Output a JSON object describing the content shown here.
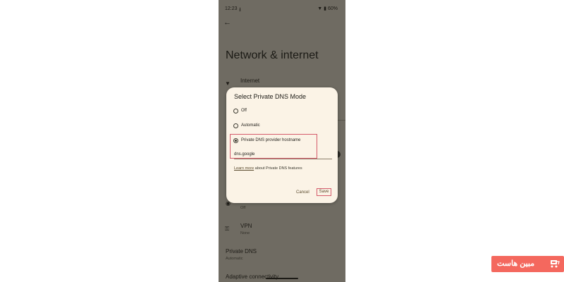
{
  "status_bar": {
    "time": "12:23",
    "battery": "60%"
  },
  "page": {
    "title": "Network & internet"
  },
  "settings_rows": {
    "internet": {
      "title": "Internet"
    },
    "hotspot": {
      "sub": "Off"
    },
    "vpn": {
      "title": "VPN",
      "sub": "None"
    },
    "private_dns": {
      "title": "Private DNS",
      "sub": "Automatic"
    },
    "adaptive": {
      "title": "Adaptive connectivity"
    }
  },
  "dialog": {
    "title": "Select Private DNS Mode",
    "options": [
      {
        "label": "Off",
        "checked": false
      },
      {
        "label": "Automatic",
        "checked": false
      },
      {
        "label": "Private DNS provider hostname",
        "checked": true
      }
    ],
    "hostname_value": "dns.google",
    "learn_more_link": "Learn more",
    "learn_more_rest": " about Private DNS features",
    "cancel_label": "Cancel",
    "save_label": "Save"
  },
  "watermark": {
    "text": "مبین هاست"
  },
  "colors": {
    "scrim": "#6f6b62",
    "dialog_bg": "#fbf3e6",
    "highlight": "#d45a6a",
    "watermark_bg": "#f4685e"
  }
}
